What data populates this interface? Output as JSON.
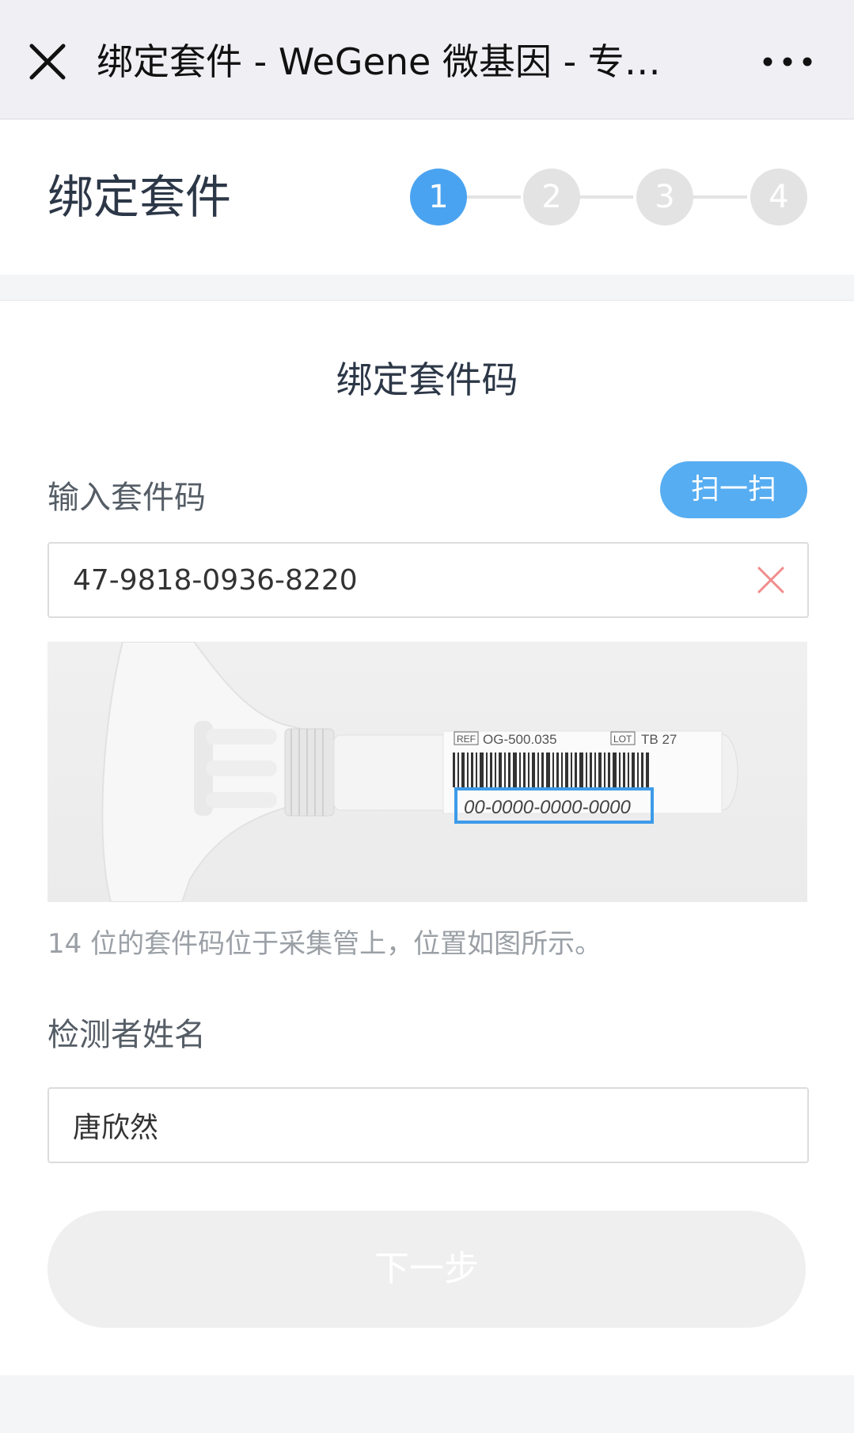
{
  "nav": {
    "title": "绑定套件 - WeGene 微基因 - 专…",
    "close_icon": "close-icon",
    "more_icon": "more-icon"
  },
  "header": {
    "title": "绑定套件",
    "steps": [
      "1",
      "2",
      "3",
      "4"
    ],
    "active_step": 1,
    "accent_color": "#4aa3f0"
  },
  "form": {
    "section_title": "绑定套件码",
    "kit_code": {
      "label": "输入套件码",
      "value": "47-9818-0936-8220",
      "scan_button": "扫一扫"
    },
    "tube_image": {
      "ref_label": "REF",
      "ref_code": "OG-500.035",
      "lot_label": "LOT",
      "lot_code": "TB 27",
      "code_example": "00-0000-0000-0000"
    },
    "hint": "14 位的套件码位于采集管上，位置如图所示。",
    "name": {
      "label": "检测者姓名",
      "value": "唐欣然"
    },
    "next_button": "下一步"
  }
}
